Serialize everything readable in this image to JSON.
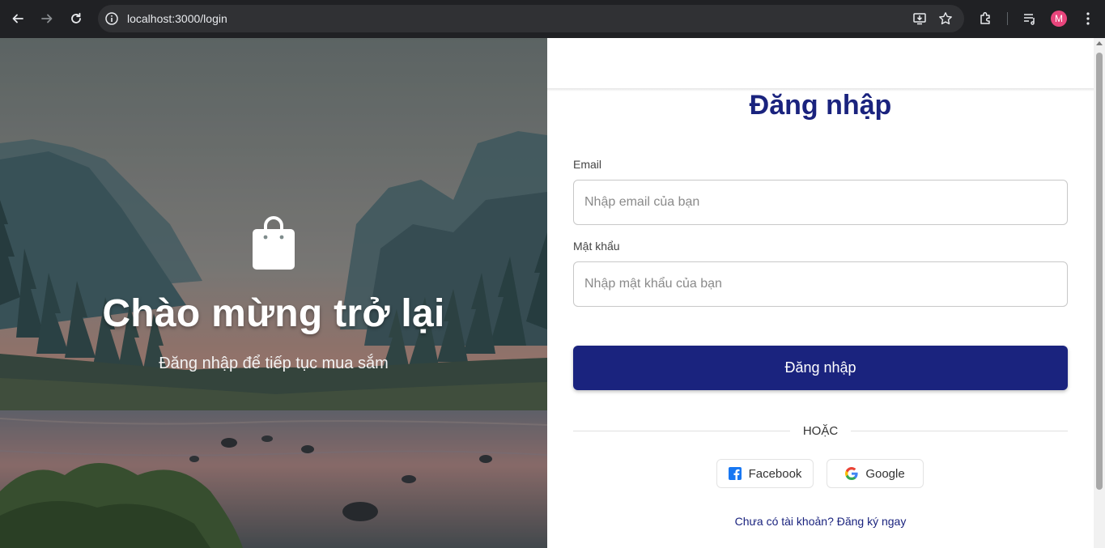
{
  "browser": {
    "url": "localhost:3000/login",
    "profile_initial": "M",
    "icons": [
      "back-icon",
      "forward-icon",
      "reload-icon",
      "site-info-icon",
      "install-app-icon",
      "bookmark-star-icon",
      "extensions-icon",
      "media-control-icon",
      "kebab-menu-icon"
    ]
  },
  "hero": {
    "icon": "shopping-bag-icon",
    "title": "Chào mừng trở lại",
    "subtitle": "Đăng nhập để tiếp tục mua sắm"
  },
  "form": {
    "title": "Đăng nhập",
    "email_label": "Email",
    "email_placeholder": "Nhập email của bạn",
    "password_label": "Mật khẩu",
    "password_placeholder": "Nhập mật khẩu của bạn",
    "submit_label": "Đăng nhập",
    "divider_text": "HOẶC",
    "social": {
      "facebook_label": "Facebook",
      "google_label": "Google"
    },
    "signup_text": "Chưa có tài khoản? Đăng ký ngay"
  },
  "colors": {
    "primary": "#1a237e",
    "avatar": "#e8457c",
    "facebook": "#1877f2",
    "chrome_bg": "#202124"
  }
}
